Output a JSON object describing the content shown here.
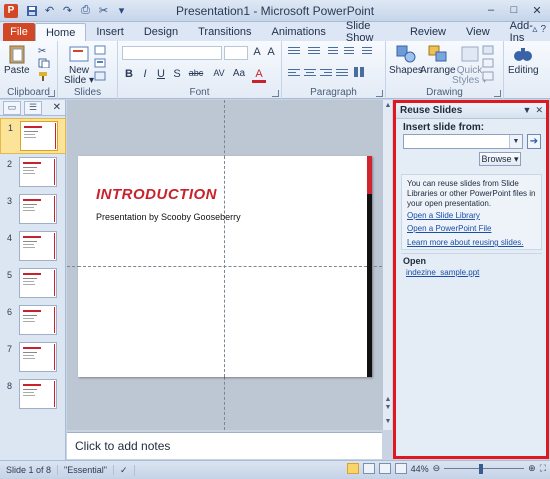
{
  "window": {
    "title": "Presentation1 - Microsoft PowerPoint",
    "app_icon": "P",
    "controls": [
      "–",
      "□",
      "✕"
    ]
  },
  "qat": {
    "icons": [
      "save-icon",
      "undo-icon",
      "redo-icon",
      "print-icon",
      "cut-icon",
      "customize-icon"
    ]
  },
  "tabs": [
    {
      "label": "File"
    },
    {
      "label": "Home"
    },
    {
      "label": "Insert"
    },
    {
      "label": "Design"
    },
    {
      "label": "Transitions"
    },
    {
      "label": "Animations"
    },
    {
      "label": "Slide Show"
    },
    {
      "label": "Review"
    },
    {
      "label": "View"
    },
    {
      "label": "Add-Ins"
    }
  ],
  "ribbon": {
    "groups": {
      "clipboard": "Clipboard",
      "slides": "Slides",
      "font": "Font",
      "paragraph": "Paragraph",
      "drawing": "Drawing",
      "editing": ""
    },
    "buttons": {
      "paste": "Paste",
      "new_slide_1": "New",
      "new_slide_2": "Slide ▾",
      "shapes": "Shapes",
      "arrange": "Arrange",
      "quick_styles_1": "Quick",
      "quick_styles_2": "Styles ▾",
      "editing": "Editing"
    },
    "format_buttons": [
      "B",
      "I",
      "U",
      "S",
      "abc",
      "AV",
      "Aa",
      "A"
    ]
  },
  "thumbnails": [
    {
      "num": "1",
      "selected": true
    },
    {
      "num": "2"
    },
    {
      "num": "3"
    },
    {
      "num": "4"
    },
    {
      "num": "5"
    },
    {
      "num": "6"
    },
    {
      "num": "7"
    },
    {
      "num": "8"
    }
  ],
  "slide": {
    "title": "INTRODUCTION",
    "subtitle": "Presentation by Scooby Gooseberry"
  },
  "notes": {
    "placeholder": "Click to add notes"
  },
  "reuse_pane": {
    "title": "Reuse Slides",
    "insert_from_label": "Insert slide from:",
    "insert_value": "",
    "browse_label": "Browse ▾",
    "info_text": "You can reuse slides from Slide Libraries or other PowerPoint files in your open presentation.",
    "links": [
      "Open a Slide Library",
      "Open a PowerPoint File",
      "Learn more about reusing slides."
    ],
    "open_label": "Open",
    "open_file": "indezine_sample.ppt",
    "highlight_color": "#e1171f"
  },
  "status": {
    "slide": "Slide 1 of 8",
    "theme": "\"Essential\"",
    "zoom": "44%"
  },
  "colors": {
    "accent_red": "#c8232c",
    "file_tab": "#d24726"
  }
}
